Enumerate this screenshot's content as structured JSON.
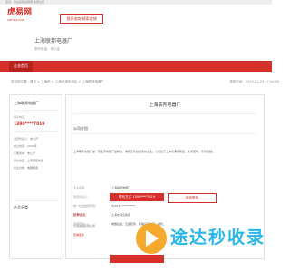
{
  "topbar": {
    "text": "您好，欢迎来到虎易网 免费注册"
  },
  "header": {
    "logo": "虎易网",
    "logo_sub": "CNHYW.COM",
    "search_button": "搜索电商·搜索店铺",
    "company_name": "上海联邦电器厂",
    "company_sub": "联系电话：请认证"
  },
  "nav": {
    "item": "企业首页"
  },
  "breadcrumb": "您当前位置：首页 > 上海市 > 上海市浦东新区 > 上海联邦电器厂",
  "updated": "更新时间：2023-01-29 17:04:58",
  "sidebar": {
    "title": "上海联邦电器厂",
    "contact_label": "联系电话",
    "phone": "1390****7019",
    "rows": [
      "法定代表人：未公开",
      "成立时间：2003年",
      "注册资本：未公开",
      "所在地区：上海浦东新区",
      "行业分类：电器制造"
    ],
    "products_title": "产品分类"
  },
  "main": {
    "title": "上海联邦电器厂",
    "section_intro": "公司介绍",
    "intro": "上海联邦电器厂是一家主营电器产品制造、销售及售后服务的企业。公司位于上海市浦东新区，交通便利，环境优越。",
    "info_rows": [
      {
        "k": "企业名称：",
        "v": "上海联邦电器厂"
      },
      {
        "k": "法定代表人：",
        "v": "黄达明"
      },
      {
        "k": "统一社会信用代码：",
        "v": "310115**********"
      },
      {
        "k": "注册地址：",
        "v": "上海市浦东新区"
      },
      {
        "k": "经营范围：",
        "v": "电器设备、五金配件、机械设备生产、销售。"
      }
    ],
    "btn_contact": "联系方式 1390****7019",
    "btn_wechat": "微信联系",
    "news_title": "推荐企业",
    "news_item": "上海某某有限公司",
    "news_item2": "查看更多"
  },
  "watermark": {
    "text": "途达秒收录",
    "colors": {
      "circle": "#f5a623",
      "text": "#29b6e9"
    }
  },
  "colors": {
    "brand": "#d6302b"
  }
}
